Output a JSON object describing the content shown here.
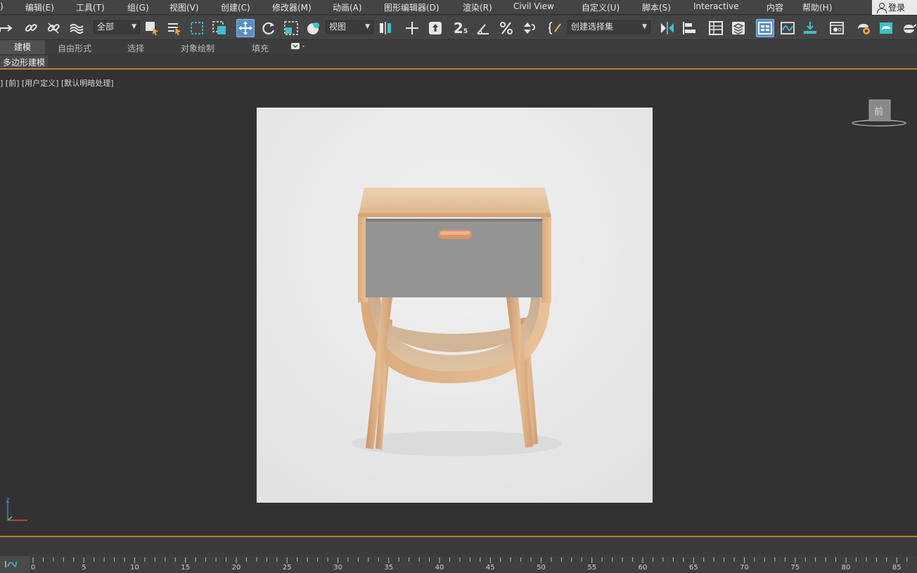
{
  "menubar": {
    "items": [
      "编辑(E)",
      "工具(T)",
      "组(G)",
      "视图(V)",
      "创建(C)",
      "修改器(M)",
      "动画(A)",
      "图形编辑器(D)",
      "渲染(R)",
      "Civil View",
      "自定义(U)",
      "脚本(S)",
      "Interactive",
      "内容",
      "帮助(H)"
    ],
    "login": "登录"
  },
  "toolbar": {
    "selection_filter": "全部",
    "reference_coord": "视图",
    "named_selection": "创建选择集",
    "snap_label": "2",
    "snap_sub": "5"
  },
  "ribbon": {
    "tabs": [
      "建模",
      "自由形式",
      "选择",
      "对象绘制",
      "填充"
    ],
    "active_tab": "建模",
    "subtab": "多边形建模"
  },
  "viewport": {
    "label": "] [前] [用户定义] [默认明暗处理]",
    "viewcube_face": "前"
  },
  "timeline": {
    "curve_button": "",
    "ticks": [
      "0",
      "5",
      "10",
      "15",
      "20",
      "25",
      "30",
      "35",
      "40",
      "45",
      "50",
      "55",
      "60",
      "65",
      "70",
      "75",
      "80",
      "85"
    ]
  },
  "colors": {
    "accent": "#b3882e",
    "active_button": "#5a8ec8",
    "teal_icon": "#3ec0c8"
  }
}
